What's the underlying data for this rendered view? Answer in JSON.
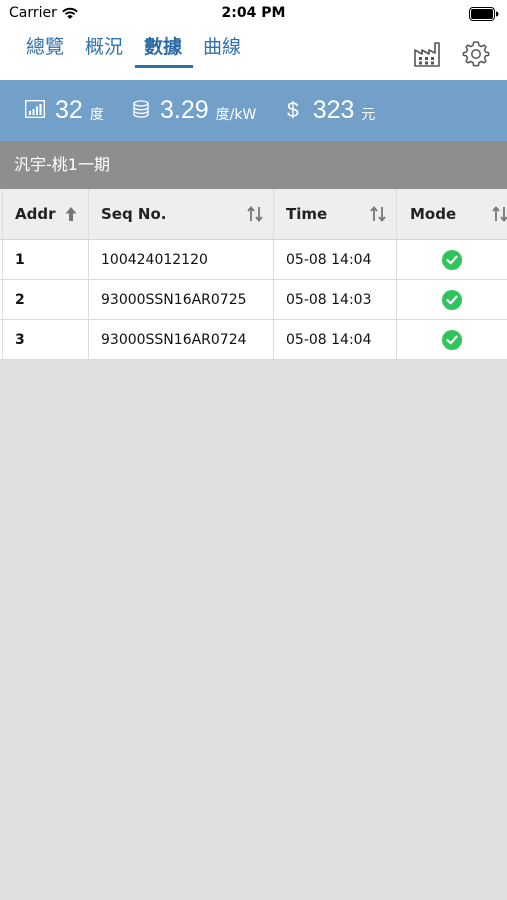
{
  "status_bar": {
    "carrier": "Carrier",
    "time": "2:04 PM"
  },
  "nav": {
    "tabs": [
      {
        "label": "總覽",
        "active": false
      },
      {
        "label": "概況",
        "active": false
      },
      {
        "label": "數據",
        "active": true
      },
      {
        "label": "曲線",
        "active": false
      }
    ],
    "icons": [
      "factory-icon",
      "gear-icon"
    ]
  },
  "summary": {
    "energy": {
      "value": "32",
      "unit": "度",
      "icon": "signal-chart-icon"
    },
    "rate": {
      "value": "3.29",
      "unit": "度/kW",
      "icon": "database-icon"
    },
    "revenue": {
      "symbol": "$",
      "value": "323",
      "unit": "元"
    }
  },
  "site": {
    "name": "汎宇-桃1一期"
  },
  "table": {
    "columns": [
      {
        "label": "Addr",
        "sort": "ascending"
      },
      {
        "label": "Seq No.",
        "sort": "none"
      },
      {
        "label": "Time",
        "sort": "none"
      },
      {
        "label": "Mode",
        "sort": "none"
      }
    ],
    "rows": [
      {
        "addr": "1",
        "seq": "100424012120",
        "time": "05-08 14:04",
        "mode": "ok"
      },
      {
        "addr": "2",
        "seq": "93000SSN16AR0725",
        "time": "05-08 14:03",
        "mode": "ok"
      },
      {
        "addr": "3",
        "seq": "93000SSN16AR0724",
        "time": "05-08 14:04",
        "mode": "ok"
      }
    ]
  },
  "colors": {
    "accent": "#2d6fa9",
    "summary_bg": "#73a0c8",
    "site_bar_bg": "#8e8e8e",
    "check_green": "#2fc45e"
  }
}
